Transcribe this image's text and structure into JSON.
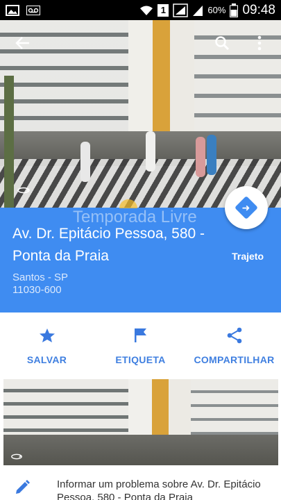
{
  "status_bar": {
    "battery": "60%",
    "time": "09:48",
    "sim": "1",
    "icons": [
      "image-icon",
      "voicemail-icon",
      "wifi-icon",
      "sim-icon",
      "signal-icon",
      "signal-icon",
      "battery-icon"
    ]
  },
  "header": {
    "back_icon": "arrow-left-icon",
    "search_icon": "search-icon",
    "menu_icon": "more-vert-icon"
  },
  "place": {
    "address": "Av. Dr. Epitácio Pessoa, 580 - Ponta da Praia",
    "city": "Santos - SP",
    "postal_code": "11030-600",
    "route_label": "Trajeto",
    "watermark": "Temporada Livre"
  },
  "actions": [
    {
      "label": "SALVAR",
      "icon": "star-icon"
    },
    {
      "label": "ETIQUETA",
      "icon": "flag-icon"
    },
    {
      "label": "COMPARTILHAR",
      "icon": "share-icon"
    }
  ],
  "report": {
    "text": "Informar um problema sobre Av. Dr. Epitácio Pessoa, 580 - Ponta da Praia"
  },
  "colors": {
    "accent": "#3f8cf1",
    "action_text": "#3f7fe0",
    "status_bar": "#000000"
  }
}
